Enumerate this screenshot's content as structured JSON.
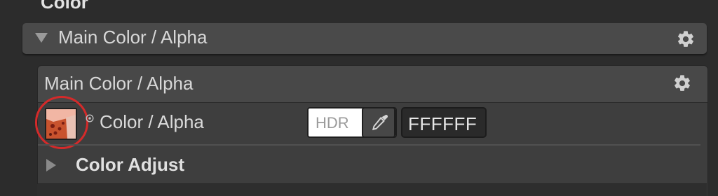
{
  "section": {
    "title": "Color"
  },
  "foldout": {
    "label": "Main Color / Alpha",
    "icon": "gear-icon"
  },
  "panel": {
    "header_label": "Main Color / Alpha",
    "header_icon": "gear-icon",
    "color_property": {
      "label": "Color / Alpha",
      "hdr_label": "HDR",
      "hex_value": "FFFFFF",
      "swatch_color": "#ffffff",
      "picker_icon": "eyedropper-icon",
      "texture_icon": "texture-thumbnail-icon"
    },
    "adjust_section": {
      "label": "Color Adjust"
    }
  },
  "colors": {
    "annotation": "#d42a2a",
    "background": "#2c2c2c",
    "panel": "#3e3e3e"
  }
}
